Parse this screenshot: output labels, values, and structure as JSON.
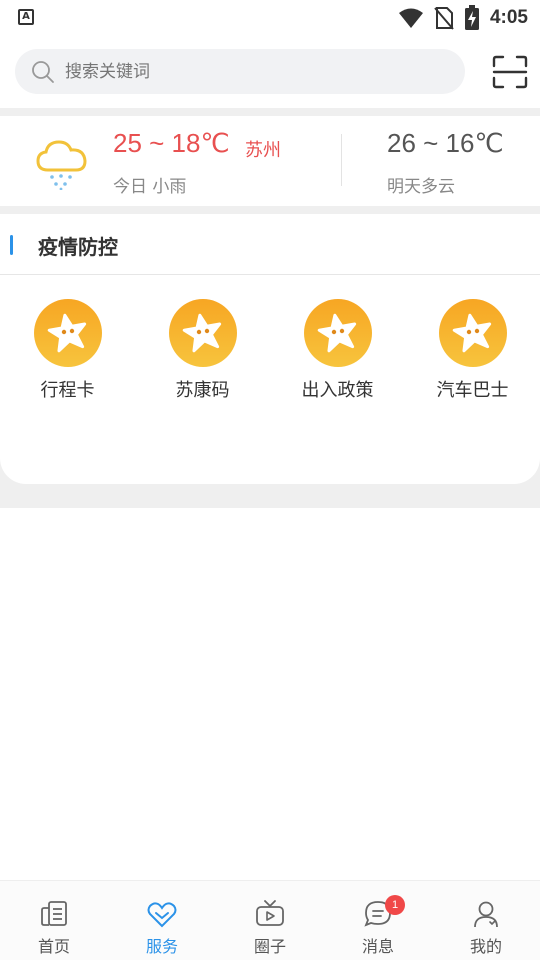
{
  "status_bar": {
    "time": "4:05",
    "left_icon": "A"
  },
  "search": {
    "placeholder": "搜索关键词"
  },
  "weather": {
    "today_temp": "25 ~ 18℃",
    "city": "苏州",
    "today_desc": "今日 小雨",
    "tomorrow_temp": "26 ~ 16℃",
    "tomorrow_desc": "明天多云",
    "icon": "rain-cloud-icon"
  },
  "epidemic": {
    "title": "疫情防控",
    "items": [
      {
        "label": "行程卡",
        "icon": "star-icon"
      },
      {
        "label": "苏康码",
        "icon": "star-icon"
      },
      {
        "label": "出入政策",
        "icon": "star-icon"
      },
      {
        "label": "汽车巴士",
        "icon": "star-icon"
      }
    ]
  },
  "bottom_nav": {
    "items": [
      {
        "label": "首页",
        "icon": "home-icon"
      },
      {
        "label": "服务",
        "icon": "service-heart-icon",
        "active": true
      },
      {
        "label": "圈子",
        "icon": "tv-icon"
      },
      {
        "label": "消息",
        "icon": "message-icon",
        "badge": "1"
      },
      {
        "label": "我的",
        "icon": "profile-icon"
      }
    ]
  },
  "colors": {
    "accent": "#2b92e8",
    "temp_red": "#e85050",
    "badge": "#f04848",
    "star_orange": "#f6a623"
  }
}
